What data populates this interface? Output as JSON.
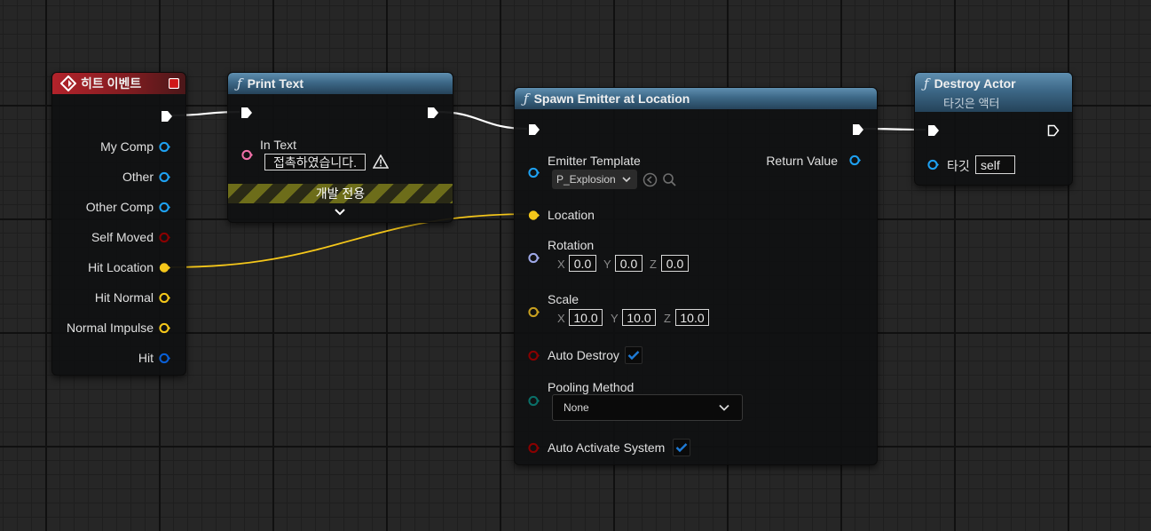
{
  "nodes": {
    "hit_event": {
      "title": "히트 이벤트",
      "outputs": [
        {
          "label": "My Comp",
          "type": "object"
        },
        {
          "label": "Other",
          "type": "object"
        },
        {
          "label": "Other Comp",
          "type": "object"
        },
        {
          "label": "Self Moved",
          "type": "bool"
        },
        {
          "label": "Hit Location",
          "type": "vector"
        },
        {
          "label": "Hit Normal",
          "type": "vector"
        },
        {
          "label": "Normal Impulse",
          "type": "vector"
        },
        {
          "label": "Hit",
          "type": "struct"
        }
      ]
    },
    "print_text": {
      "title": "Print Text",
      "in_text_label": "In Text",
      "in_text_value": "접촉하였습니다.",
      "dev_only_label": "개발 전용"
    },
    "spawn_emitter": {
      "title": "Spawn Emitter at Location",
      "emitter_template_label": "Emitter Template",
      "emitter_template_value": "P_Explosion",
      "return_value_label": "Return Value",
      "location_label": "Location",
      "rotation_label": "Rotation",
      "rotation": {
        "x": "0.0",
        "y": "0.0",
        "z": "0.0"
      },
      "scale_label": "Scale",
      "scale": {
        "x": "10.0",
        "y": "10.0",
        "z": "10.0"
      },
      "auto_destroy_label": "Auto Destroy",
      "auto_destroy_checked": true,
      "pooling_method_label": "Pooling Method",
      "pooling_method_value": "None",
      "auto_activate_label": "Auto Activate System",
      "auto_activate_checked": true
    },
    "destroy_actor": {
      "title": "Destroy Actor",
      "subtitle": "타깃은 액터",
      "target_label": "타깃",
      "target_value": "self"
    }
  },
  "axis_labels": {
    "x": "X",
    "y": "Y",
    "z": "Z"
  },
  "colors": {
    "object_pin": "#1ea1f2",
    "bool_pin": "#8a0000",
    "vector_pin": "#f5c71a",
    "vector_pin_dim": "#c8a020",
    "struct_pin": "#0a5fd6",
    "rotator_pin": "#9fa9e8",
    "enum_pin": "#0a6f68",
    "string_pin": "#f070a8",
    "exec_pin": "#ffffff",
    "event_header": "#b3232b",
    "function_header": "#3d6887",
    "checkbox_accent": "#1f7bd6"
  },
  "icons": {
    "event": "event-diamond-icon",
    "function": "function-f-icon",
    "warning": "warning-triangle-icon",
    "chevron": "chevron-down-icon",
    "browse": "browse-arrow-icon",
    "search": "search-icon",
    "check": "check-icon",
    "stop": "stop-square-icon"
  }
}
